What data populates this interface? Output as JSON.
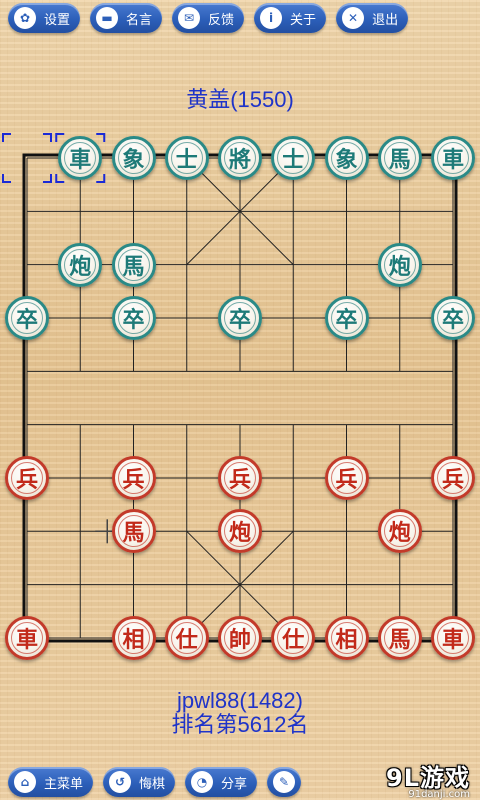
{
  "toolbar": {
    "buttons": [
      {
        "label": "设置",
        "icon": "gear-icon"
      },
      {
        "label": "名言",
        "icon": "chat-icon"
      },
      {
        "label": "反馈",
        "icon": "mail-icon"
      },
      {
        "label": "关于",
        "icon": "info-icon"
      },
      {
        "label": "退出",
        "icon": "close-icon"
      }
    ]
  },
  "players": {
    "top": "黄盖(1550)",
    "bottom": "jpwl88(1482)",
    "bottom_rank": "排名第5612名"
  },
  "board": {
    "pieces": [
      {
        "side": "black",
        "char": "車",
        "file": 1,
        "rank": 0
      },
      {
        "side": "black",
        "char": "象",
        "file": 2,
        "rank": 0
      },
      {
        "side": "black",
        "char": "士",
        "file": 3,
        "rank": 0
      },
      {
        "side": "black",
        "char": "將",
        "file": 4,
        "rank": 0
      },
      {
        "side": "black",
        "char": "士",
        "file": 5,
        "rank": 0
      },
      {
        "side": "black",
        "char": "象",
        "file": 6,
        "rank": 0
      },
      {
        "side": "black",
        "char": "馬",
        "file": 7,
        "rank": 0
      },
      {
        "side": "black",
        "char": "車",
        "file": 8,
        "rank": 0
      },
      {
        "side": "black",
        "char": "炮",
        "file": 1,
        "rank": 2
      },
      {
        "side": "black",
        "char": "馬",
        "file": 2,
        "rank": 2
      },
      {
        "side": "black",
        "char": "炮",
        "file": 7,
        "rank": 2
      },
      {
        "side": "black",
        "char": "卒",
        "file": 0,
        "rank": 3
      },
      {
        "side": "black",
        "char": "卒",
        "file": 2,
        "rank": 3
      },
      {
        "side": "black",
        "char": "卒",
        "file": 4,
        "rank": 3
      },
      {
        "side": "black",
        "char": "卒",
        "file": 6,
        "rank": 3
      },
      {
        "side": "black",
        "char": "卒",
        "file": 8,
        "rank": 3
      },
      {
        "side": "red",
        "char": "兵",
        "file": 0,
        "rank": 6
      },
      {
        "side": "red",
        "char": "兵",
        "file": 2,
        "rank": 6
      },
      {
        "side": "red",
        "char": "兵",
        "file": 4,
        "rank": 6
      },
      {
        "side": "red",
        "char": "兵",
        "file": 6,
        "rank": 6
      },
      {
        "side": "red",
        "char": "兵",
        "file": 8,
        "rank": 6
      },
      {
        "side": "red",
        "char": "馬",
        "file": 2,
        "rank": 7
      },
      {
        "side": "red",
        "char": "炮",
        "file": 4,
        "rank": 7
      },
      {
        "side": "red",
        "char": "炮",
        "file": 7,
        "rank": 7
      },
      {
        "side": "red",
        "char": "車",
        "file": 0,
        "rank": 9
      },
      {
        "side": "red",
        "char": "相",
        "file": 2,
        "rank": 9
      },
      {
        "side": "red",
        "char": "仕",
        "file": 3,
        "rank": 9
      },
      {
        "side": "red",
        "char": "帥",
        "file": 4,
        "rank": 9
      },
      {
        "side": "red",
        "char": "仕",
        "file": 5,
        "rank": 9
      },
      {
        "side": "red",
        "char": "相",
        "file": 6,
        "rank": 9
      },
      {
        "side": "red",
        "char": "馬",
        "file": 7,
        "rank": 9
      },
      {
        "side": "red",
        "char": "車",
        "file": 8,
        "rank": 9
      }
    ],
    "last_move_from": {
      "file": 0,
      "rank": 0
    },
    "last_move_to": {
      "file": 1,
      "rank": 0
    },
    "cursor": {
      "file": 1,
      "rank": 7
    }
  },
  "bottombar": {
    "buttons": [
      {
        "label": "主菜单",
        "icon": "home-icon"
      },
      {
        "label": "悔棋",
        "icon": "undo-icon"
      },
      {
        "label": "分享",
        "icon": "rss-icon"
      },
      {
        "label": "",
        "icon": "pencil-icon"
      }
    ],
    "brand": "9L游戏",
    "brand_sub": "91danji.com"
  },
  "colors": {
    "accent": "#2c5fb9",
    "black_piece": "#2a8a87",
    "red_piece": "#c33a2a",
    "player_text": "#1f34c9"
  }
}
